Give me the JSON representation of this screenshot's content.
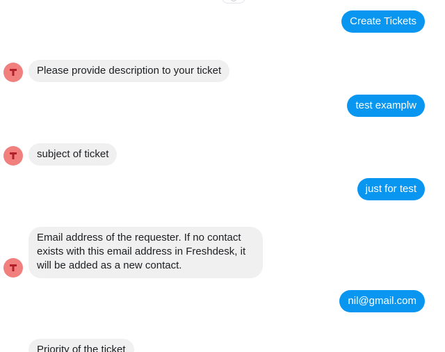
{
  "messages": [
    {
      "from": "user",
      "text": "Create Tickets"
    },
    {
      "from": "bot",
      "text": "Please provide description to your ticket"
    },
    {
      "from": "user",
      "text": "test examplw"
    },
    {
      "from": "bot",
      "text": "subject of ticket"
    },
    {
      "from": "user",
      "text": "just for test"
    },
    {
      "from": "bot",
      "text": "Email address of the requester. If no contact exists with this email address in Freshdesk, it will be added as a new contact."
    },
    {
      "from": "user",
      "text": "nil@gmail.com"
    },
    {
      "from": "bot",
      "text": "Priority of the ticket"
    }
  ],
  "bot_avatar": {
    "icon": "t-logo-icon",
    "color": "#f07f7e"
  },
  "colors": {
    "outgoing": "#0896f0",
    "incoming": "#f0f0f0"
  }
}
